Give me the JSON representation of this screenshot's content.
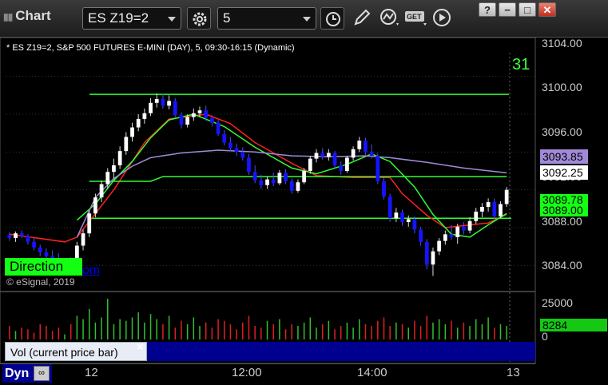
{
  "window": {
    "title": "Chart",
    "symbol": "ES Z19=2",
    "interval": "5",
    "buttons": {
      "help": "?",
      "minimize": "−",
      "maximize": "□",
      "close": "✕"
    }
  },
  "chart": {
    "subtitle": "* ES Z19=2, S&P 500 FUTURES E-MINI (DAY), 5, 09:30-16:15 (Dynamic)",
    "big_label": "31",
    "direction_label": "Direction",
    "direction_suffix": "om",
    "copyright": "© eSignal, 2019",
    "colors": {
      "up_candle": "#ffffff",
      "down_candle": "#1414ff",
      "red_line": "#ff2020",
      "green_line": "#30ff30",
      "purple_line": "#a08ad8",
      "grid": "#333333"
    }
  },
  "price_axis": {
    "labels": [
      "3104.00",
      "3100.00",
      "3096.00",
      "3092.00",
      "3088.00",
      "3084.00"
    ],
    "tags": [
      {
        "value": "3093.85",
        "bg": "#a08ad8",
        "fg": "#000000"
      },
      {
        "value": "3092.25",
        "bg": "#ffffff",
        "fg": "#000000"
      },
      {
        "value": "3089.78",
        "bg": "#14ff14",
        "fg": "#000000"
      },
      {
        "value": "3089.00",
        "bg": "#14ff14",
        "fg": "#000000"
      }
    ]
  },
  "volume": {
    "panel_label": "Vol (current price bar)",
    "axis_labels": [
      "25000",
      "0"
    ],
    "current": "8284"
  },
  "time_axis": {
    "labels": [
      "12",
      "12:00",
      "14:00",
      "13"
    ],
    "mode": "Dyn"
  },
  "chart_data": {
    "type": "candlestick",
    "title": "* ES Z19=2, S&P 500 FUTURES E-MINI (DAY), 5, 09:30-16:15 (Dynamic)",
    "ylim": [
      3081.5,
      3106.5
    ],
    "candles": [
      [
        3087.2,
        3087.5,
        3086.6,
        3086.9
      ],
      [
        3086.9,
        3087.6,
        3086.5,
        3087.4
      ],
      [
        3087.4,
        3087.7,
        3086.9,
        3087.1
      ],
      [
        3087.1,
        3087.3,
        3086.2,
        3086.5
      ],
      [
        3086.5,
        3086.9,
        3085.6,
        3085.9
      ],
      [
        3085.9,
        3086.2,
        3085.0,
        3085.4
      ],
      [
        3085.4,
        3085.8,
        3084.6,
        3085.0
      ],
      [
        3085.0,
        3085.6,
        3084.4,
        3084.8
      ],
      [
        3084.8,
        3085.3,
        3083.9,
        3084.2
      ],
      [
        3084.2,
        3084.8,
        3083.8,
        3084.5
      ],
      [
        3084.5,
        3084.9,
        3083.4,
        3083.7
      ],
      [
        3084.2,
        3086.5,
        3083.8,
        3086.1
      ],
      [
        3086.1,
        3087.8,
        3085.6,
        3087.4
      ],
      [
        3087.4,
        3089.8,
        3087.0,
        3089.5
      ],
      [
        3089.5,
        3091.6,
        3089.1,
        3091.2
      ],
      [
        3091.2,
        3093.0,
        3090.7,
        3092.6
      ],
      [
        3092.6,
        3094.3,
        3092.1,
        3093.9
      ],
      [
        3093.9,
        3095.3,
        3093.2,
        3094.6
      ],
      [
        3094.6,
        3096.6,
        3094.2,
        3096.1
      ],
      [
        3096.1,
        3098.1,
        3095.7,
        3097.6
      ],
      [
        3097.6,
        3099.1,
        3097.1,
        3098.6
      ],
      [
        3098.6,
        3100.0,
        3098.2,
        3099.5
      ],
      [
        3099.5,
        3100.6,
        3099.0,
        3100.1
      ],
      [
        3100.1,
        3101.7,
        3099.8,
        3101.2
      ],
      [
        3101.2,
        3102.2,
        3100.7,
        3101.6
      ],
      [
        3101.6,
        3102.1,
        3100.6,
        3100.9
      ],
      [
        3100.9,
        3102.0,
        3100.5,
        3101.4
      ],
      [
        3101.4,
        3101.7,
        3099.7,
        3099.9
      ],
      [
        3099.9,
        3100.2,
        3098.5,
        3098.9
      ],
      [
        3098.9,
        3100.0,
        3098.6,
        3099.7
      ],
      [
        3099.7,
        3100.6,
        3099.3,
        3100.1
      ],
      [
        3100.1,
        3100.8,
        3099.7,
        3100.4
      ],
      [
        3100.4,
        3100.9,
        3099.3,
        3099.6
      ],
      [
        3099.6,
        3099.9,
        3098.7,
        3099.1
      ],
      [
        3099.1,
        3099.4,
        3097.7,
        3097.9
      ],
      [
        3097.9,
        3098.3,
        3096.7,
        3097.0
      ],
      [
        3097.0,
        3097.6,
        3096.1,
        3096.4
      ],
      [
        3096.4,
        3096.9,
        3095.6,
        3096.0
      ],
      [
        3096.0,
        3096.5,
        3095.1,
        3095.4
      ],
      [
        3095.4,
        3095.8,
        3093.6,
        3093.9
      ],
      [
        3093.9,
        3094.6,
        3092.7,
        3093.0
      ],
      [
        3093.0,
        3093.6,
        3092.1,
        3092.5
      ],
      [
        3092.5,
        3093.4,
        3092.1,
        3093.1
      ],
      [
        3093.1,
        3093.8,
        3092.4,
        3092.7
      ],
      [
        3092.7,
        3094.1,
        3092.5,
        3093.8
      ],
      [
        3093.8,
        3094.2,
        3092.6,
        3092.9
      ],
      [
        3092.9,
        3093.2,
        3091.6,
        3091.9
      ],
      [
        3091.9,
        3093.1,
        3091.7,
        3092.8
      ],
      [
        3092.8,
        3094.3,
        3092.6,
        3094.0
      ],
      [
        3094.0,
        3095.6,
        3093.7,
        3095.3
      ],
      [
        3095.3,
        3096.3,
        3094.9,
        3095.9
      ],
      [
        3095.9,
        3096.4,
        3095.2,
        3095.5
      ],
      [
        3095.5,
        3096.3,
        3095.1,
        3095.9
      ],
      [
        3095.9,
        3096.1,
        3094.3,
        3094.6
      ],
      [
        3094.6,
        3095.0,
        3093.6,
        3094.0
      ],
      [
        3094.0,
        3095.6,
        3093.8,
        3095.4
      ],
      [
        3095.4,
        3096.6,
        3095.1,
        3096.3
      ],
      [
        3096.3,
        3097.6,
        3096.0,
        3097.2
      ],
      [
        3097.2,
        3097.5,
        3095.7,
        3096.0
      ],
      [
        3096.0,
        3096.8,
        3095.3,
        3095.6
      ],
      [
        3095.6,
        3095.9,
        3092.6,
        3092.9
      ],
      [
        3092.9,
        3093.3,
        3091.0,
        3091.3
      ],
      [
        3091.3,
        3091.6,
        3088.6,
        3089.0
      ],
      [
        3089.0,
        3090.1,
        3088.6,
        3089.6
      ],
      [
        3089.6,
        3089.9,
        3088.2,
        3088.6
      ],
      [
        3088.6,
        3089.3,
        3088.1,
        3088.9
      ],
      [
        3088.9,
        3089.2,
        3087.4,
        3087.8
      ],
      [
        3087.8,
        3088.1,
        3086.1,
        3086.5
      ],
      [
        3086.5,
        3086.8,
        3083.6,
        3084.1
      ],
      [
        3084.1,
        3085.9,
        3082.9,
        3085.5
      ],
      [
        3085.5,
        3086.9,
        3085.1,
        3086.6
      ],
      [
        3086.6,
        3087.7,
        3086.2,
        3087.3
      ],
      [
        3087.3,
        3088.3,
        3086.7,
        3087.0
      ],
      [
        3087.0,
        3088.4,
        3086.3,
        3088.1
      ],
      [
        3088.1,
        3088.6,
        3087.3,
        3087.7
      ],
      [
        3087.7,
        3089.1,
        3087.4,
        3088.7
      ],
      [
        3088.7,
        3090.1,
        3088.4,
        3089.7
      ],
      [
        3089.7,
        3090.6,
        3089.1,
        3090.2
      ],
      [
        3090.2,
        3091.1,
        3089.7,
        3090.7
      ],
      [
        3090.7,
        3091.1,
        3088.9,
        3089.2
      ],
      [
        3089.2,
        3090.8,
        3089.0,
        3090.5
      ],
      [
        3090.5,
        3092.3,
        3090.2,
        3092.0
      ]
    ],
    "series": [
      {
        "name": "red",
        "values": [
          [
            3087.3,
            0
          ],
          [
            3086.5,
            9
          ],
          [
            3087.0,
            11
          ],
          [
            3092.0,
            17
          ],
          [
            3097.0,
            22
          ],
          [
            3099.5,
            26
          ],
          [
            3100.0,
            32
          ],
          [
            3099.0,
            36
          ],
          [
            3097.0,
            40
          ],
          [
            3094.8,
            46
          ],
          [
            3093.5,
            50
          ],
          [
            3093.3,
            56
          ],
          [
            3093.3,
            62
          ],
          [
            3091.6,
            64
          ],
          [
            3089.3,
            68
          ],
          [
            3088.0,
            71
          ],
          [
            3088.5,
            78
          ],
          [
            3089.4,
            81
          ]
        ]
      },
      {
        "name": "green",
        "values": [
          [
            3088.8,
            11
          ],
          [
            3090.5,
            14
          ],
          [
            3093.0,
            17
          ],
          [
            3095.0,
            20
          ],
          [
            3097.5,
            23
          ],
          [
            3099.4,
            26
          ],
          [
            3100.0,
            30
          ],
          [
            3098.7,
            35
          ],
          [
            3096.5,
            40
          ],
          [
            3094.3,
            46
          ],
          [
            3093.7,
            50
          ],
          [
            3094.7,
            55
          ],
          [
            3095.8,
            59
          ],
          [
            3095.0,
            62
          ],
          [
            3092.3,
            66
          ],
          [
            3089.4,
            69
          ],
          [
            3087.3,
            72
          ],
          [
            3087.0,
            75
          ],
          [
            3088.3,
            78
          ],
          [
            3089.5,
            81
          ]
        ]
      },
      {
        "name": "green-flat",
        "values": [
          [
            3092.9,
            13
          ],
          [
            3092.9,
            23
          ],
          [
            3093.4,
            25
          ],
          [
            3093.4,
            81
          ]
        ]
      },
      {
        "name": "purple",
        "values": [
          [
            3087.0,
            11
          ],
          [
            3091.2,
            14
          ],
          [
            3093.2,
            17
          ],
          [
            3094.5,
            20
          ],
          [
            3095.4,
            23
          ],
          [
            3095.9,
            28
          ],
          [
            3096.2,
            34
          ],
          [
            3096.0,
            40
          ],
          [
            3095.6,
            46
          ],
          [
            3095.5,
            52
          ],
          [
            3095.6,
            58
          ],
          [
            3095.4,
            62
          ],
          [
            3094.9,
            68
          ],
          [
            3094.3,
            74
          ],
          [
            3093.8,
            81
          ]
        ]
      }
    ],
    "lines": [
      {
        "value": 3102.1,
        "label": "31"
      },
      {
        "value": 3089.0,
        "label": "3089.00"
      }
    ],
    "volume": [
      8,
      5,
      7,
      6,
      4,
      9,
      8,
      5,
      7,
      3,
      9,
      14,
      12,
      18,
      10,
      13,
      24,
      9,
      12,
      11,
      13,
      16,
      10,
      15,
      12,
      9,
      14,
      7,
      11,
      9,
      13,
      8,
      10,
      7,
      12,
      11,
      9,
      6,
      10,
      14,
      8,
      7,
      11,
      9,
      12,
      6,
      9,
      8,
      10,
      13,
      7,
      9,
      11,
      6,
      8,
      10,
      7,
      12,
      9,
      8,
      11,
      13,
      8,
      10,
      9,
      7,
      11,
      8,
      14,
      10,
      12,
      9,
      11,
      7,
      10,
      8,
      12,
      9,
      13,
      7,
      9,
      8
    ]
  }
}
